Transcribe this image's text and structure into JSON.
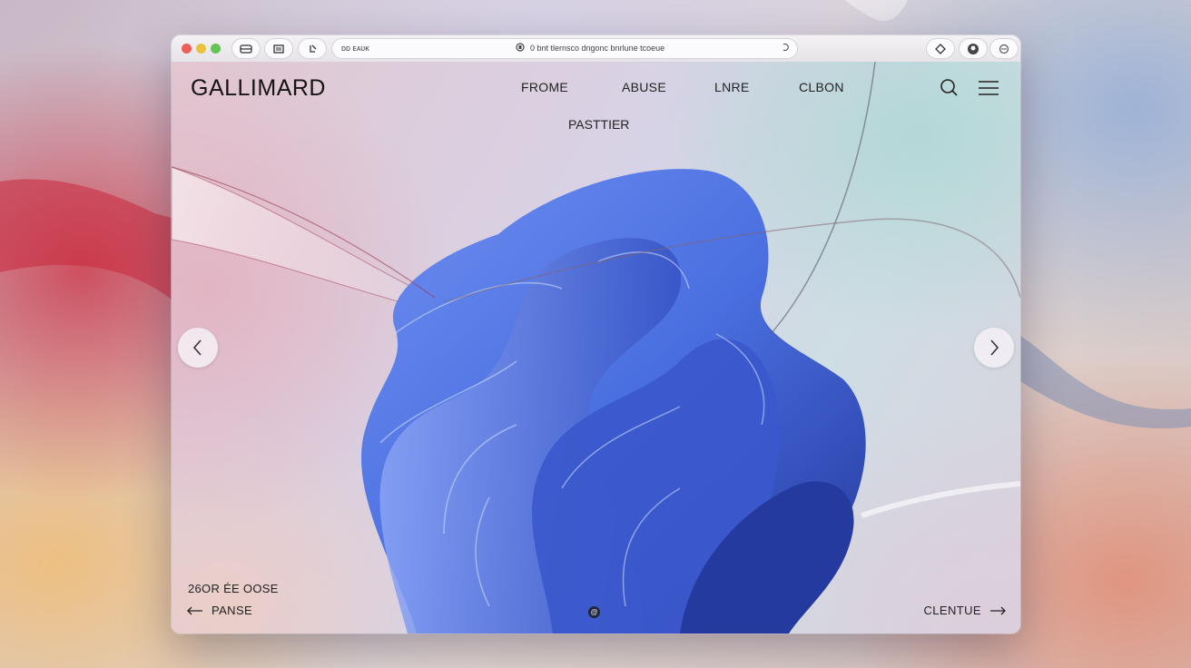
{
  "browser": {
    "toolbar_left_text": "ᴅᴅ  ᴇᴀᴜᴋ",
    "address_text": "0 bnt tlernsco dngonc bnrlune tcoeue",
    "lock_glyph": "🔒",
    "reload_glyph": "↻"
  },
  "site": {
    "logo": "GALLIMARD",
    "nav": [
      "FROME",
      "ABUSE",
      "LNRE",
      "CLBON"
    ],
    "sub_nav": "PASTTIER",
    "caption": "26OR ÉE OOSE",
    "prev_label": "PANSE",
    "next_label": "CLENTUE",
    "pager_glyph": "@"
  },
  "colors": {
    "artwork_blue": "#4a6fe0",
    "artwork_deep": "#2a3fa8",
    "text": "#141414"
  },
  "icons": [
    "search-icon",
    "menu-icon",
    "chevron-left-icon",
    "chevron-right-icon",
    "arrow-left-icon",
    "arrow-right-icon"
  ]
}
